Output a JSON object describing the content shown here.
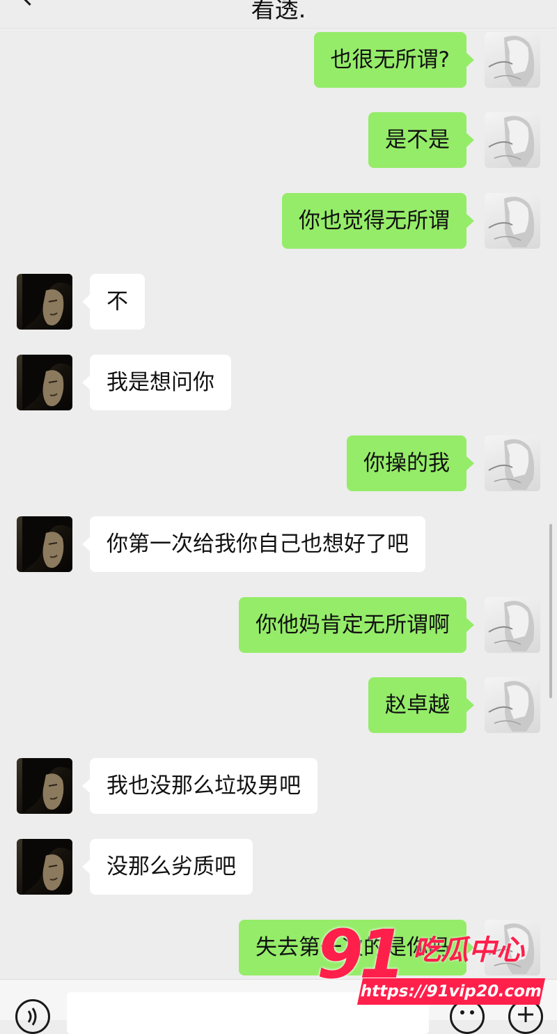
{
  "header": {
    "title": "看透."
  },
  "messages": [
    {
      "side": "right",
      "text": "也很无所谓?"
    },
    {
      "side": "right",
      "text": "是不是"
    },
    {
      "side": "right",
      "text": "你也觉得无所谓"
    },
    {
      "side": "left",
      "text": "不"
    },
    {
      "side": "left",
      "text": "我是想问你"
    },
    {
      "side": "right",
      "text": "你操的我"
    },
    {
      "side": "left",
      "text": "你第一次给我你自己也想好了吧"
    },
    {
      "side": "right",
      "text": "你他妈肯定无所谓啊"
    },
    {
      "side": "right",
      "text": "赵卓越"
    },
    {
      "side": "left",
      "text": "我也没那么垃圾男吧"
    },
    {
      "side": "left",
      "text": "没那么劣质吧"
    },
    {
      "side": "right",
      "text": "失去第一次的是你吗"
    }
  ],
  "watermark": {
    "number": "91",
    "site_name": "吃瓜中心",
    "url": "https://91vip20.com"
  },
  "icons": {
    "back": "chevron-left-icon",
    "voice": "voice-icon",
    "emoji": "emoji-icon",
    "more": "plus-icon"
  },
  "colors": {
    "background": "#ededed",
    "sent_bubble": "#95ec69",
    "received_bubble": "#ffffff",
    "watermark": "#ff1f4b"
  }
}
